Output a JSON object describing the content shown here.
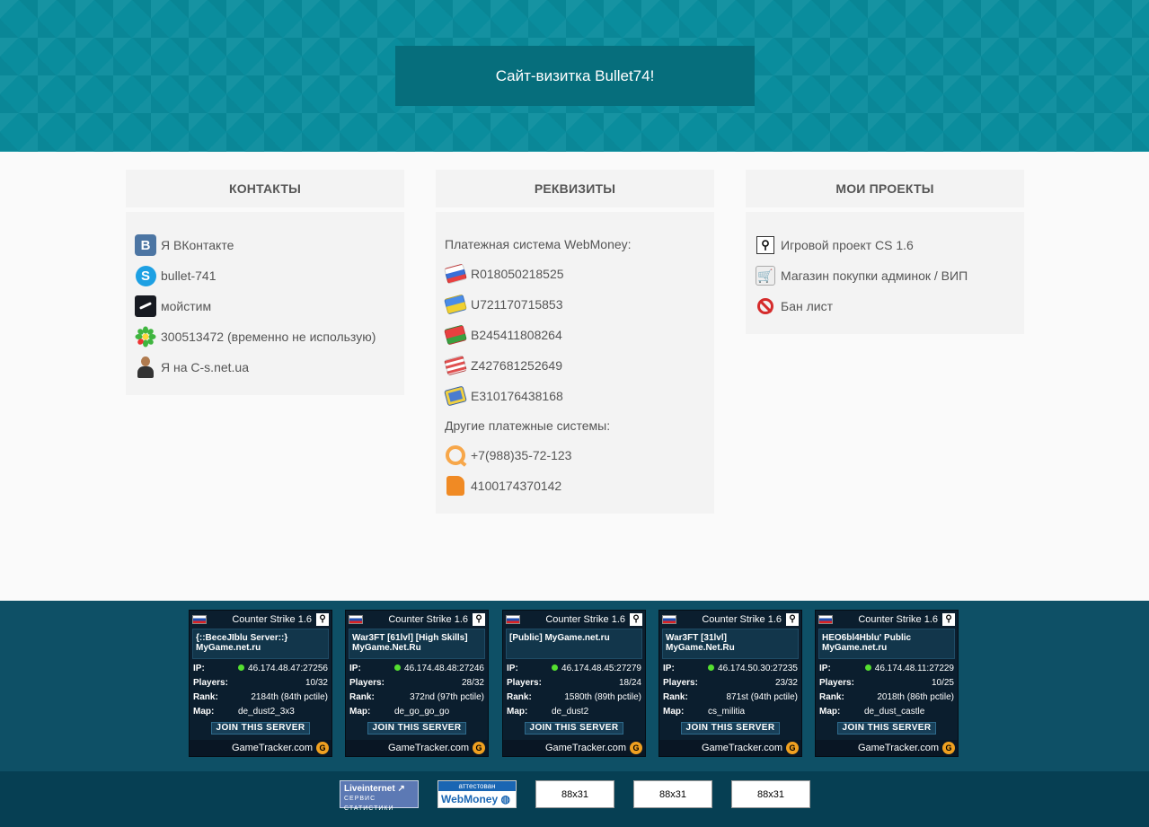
{
  "header": {
    "title": "Сайт-визитка Bullet74!"
  },
  "contacts": {
    "heading": "КОНТАКТЫ",
    "items": [
      {
        "icon": "vk-icon",
        "label": "Я ВКонтакте"
      },
      {
        "icon": "skype-icon",
        "label": "bullet-741"
      },
      {
        "icon": "steam-icon",
        "label": "мойстим"
      },
      {
        "icon": "icq-icon",
        "label": "300513472 (временно не использую)"
      },
      {
        "icon": "person-icon",
        "label": "Я на C-s.net.ua"
      }
    ]
  },
  "requisites": {
    "heading": "РЕКВИЗИТЫ",
    "webmoney_title": "Платежная система WebMoney:",
    "wallets": [
      {
        "icon": "wmr-wallet-icon",
        "color": "#e86a6a",
        "label": "R018050218525"
      },
      {
        "icon": "wmu-wallet-icon",
        "color": "#f0c830",
        "label": "U721170715853"
      },
      {
        "icon": "wmb-wallet-icon",
        "color": "#e8863a",
        "label": "B245411808264"
      },
      {
        "icon": "wmz-wallet-icon",
        "color": "#e8b050",
        "label": "Z427681252649"
      },
      {
        "icon": "wme-wallet-icon",
        "color": "#6aa8d8",
        "label": "E310176438168"
      }
    ],
    "other_title": "Другие платежные системы:",
    "other": [
      {
        "icon": "qiwi-icon",
        "label": "+7(988)35-72-123"
      },
      {
        "icon": "yandex-money-icon",
        "label": "4100174370142"
      }
    ]
  },
  "projects": {
    "heading": "МОИ ПРОЕКТЫ",
    "items": [
      {
        "icon": "counter-strike-icon",
        "label": "Игровой проект CS 1.6"
      },
      {
        "icon": "shopping-cart-icon",
        "label": "Магазин покупки админок / ВИП"
      },
      {
        "icon": "ban-icon",
        "label": "Бан лист"
      }
    ]
  },
  "servers": {
    "labels": {
      "ip": "IP:",
      "players": "Players:",
      "rank": "Rank:",
      "map": "Map:",
      "join": "JOIN THIS SERVER",
      "footer": "GameTracker.com",
      "game": "Counter Strike 1.6"
    },
    "items": [
      {
        "name": "{::BeceJIblu Server::}\nMyGame.net.ru",
        "ip": "46.174.48.47:27256",
        "players": "10/32",
        "rank": "2184th (84th pctile)",
        "map": "de_dust2_3x3"
      },
      {
        "name": "War3FT [61lvl] [High Skills]\nMyGame.Net.Ru",
        "ip": "46.174.48.48:27246",
        "players": "28/32",
        "rank": "372nd (97th pctile)",
        "map": "de_go_go_go"
      },
      {
        "name": "[Public] MyGame.net.ru",
        "ip": "46.174.48.45:27279",
        "players": "18/24",
        "rank": "1580th (89th pctile)",
        "map": "de_dust2"
      },
      {
        "name": "War3FT [31lvl]\nMyGame.Net.Ru",
        "ip": "46.174.50.30:27235",
        "players": "23/32",
        "rank": "871st (94th pctile)",
        "map": "cs_militia"
      },
      {
        "name": "HEO6bl4Hblu' Public\nMyGame.net.ru",
        "ip": "46.174.48.11:27229",
        "players": "10/25",
        "rank": "2018th (86th pctile)",
        "map": "de_dust_castle"
      }
    ]
  },
  "banners": {
    "liveinternet": {
      "title": "Liveinternet",
      "sub": "СЕРВИС СТАТИСТИКИ"
    },
    "webmoney": {
      "top": "аттестован",
      "bottom": "WebMoney"
    },
    "placeholders": [
      "88x31",
      "88x31",
      "88x31"
    ]
  }
}
